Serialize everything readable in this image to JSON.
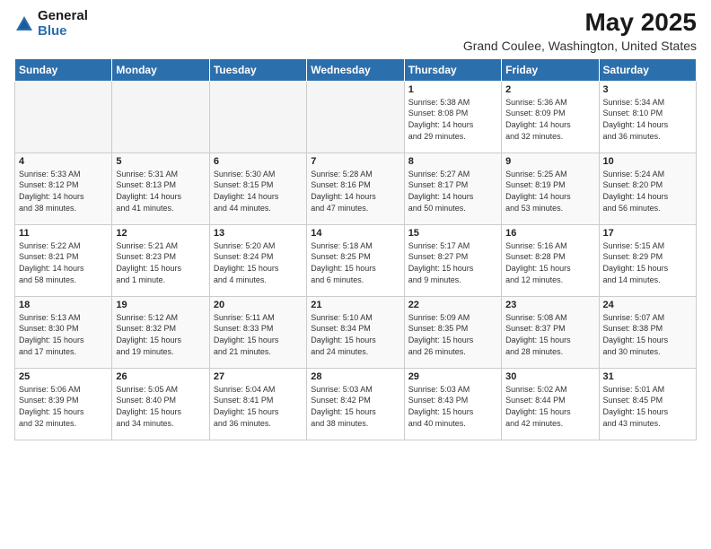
{
  "header": {
    "logo_general": "General",
    "logo_blue": "Blue",
    "main_title": "May 2025",
    "sub_title": "Grand Coulee, Washington, United States"
  },
  "weekdays": [
    "Sunday",
    "Monday",
    "Tuesday",
    "Wednesday",
    "Thursday",
    "Friday",
    "Saturday"
  ],
  "weeks": [
    [
      {
        "num": "",
        "info": ""
      },
      {
        "num": "",
        "info": ""
      },
      {
        "num": "",
        "info": ""
      },
      {
        "num": "",
        "info": ""
      },
      {
        "num": "1",
        "info": "Sunrise: 5:38 AM\nSunset: 8:08 PM\nDaylight: 14 hours\nand 29 minutes."
      },
      {
        "num": "2",
        "info": "Sunrise: 5:36 AM\nSunset: 8:09 PM\nDaylight: 14 hours\nand 32 minutes."
      },
      {
        "num": "3",
        "info": "Sunrise: 5:34 AM\nSunset: 8:10 PM\nDaylight: 14 hours\nand 36 minutes."
      }
    ],
    [
      {
        "num": "4",
        "info": "Sunrise: 5:33 AM\nSunset: 8:12 PM\nDaylight: 14 hours\nand 38 minutes."
      },
      {
        "num": "5",
        "info": "Sunrise: 5:31 AM\nSunset: 8:13 PM\nDaylight: 14 hours\nand 41 minutes."
      },
      {
        "num": "6",
        "info": "Sunrise: 5:30 AM\nSunset: 8:15 PM\nDaylight: 14 hours\nand 44 minutes."
      },
      {
        "num": "7",
        "info": "Sunrise: 5:28 AM\nSunset: 8:16 PM\nDaylight: 14 hours\nand 47 minutes."
      },
      {
        "num": "8",
        "info": "Sunrise: 5:27 AM\nSunset: 8:17 PM\nDaylight: 14 hours\nand 50 minutes."
      },
      {
        "num": "9",
        "info": "Sunrise: 5:25 AM\nSunset: 8:19 PM\nDaylight: 14 hours\nand 53 minutes."
      },
      {
        "num": "10",
        "info": "Sunrise: 5:24 AM\nSunset: 8:20 PM\nDaylight: 14 hours\nand 56 minutes."
      }
    ],
    [
      {
        "num": "11",
        "info": "Sunrise: 5:22 AM\nSunset: 8:21 PM\nDaylight: 14 hours\nand 58 minutes."
      },
      {
        "num": "12",
        "info": "Sunrise: 5:21 AM\nSunset: 8:23 PM\nDaylight: 15 hours\nand 1 minute."
      },
      {
        "num": "13",
        "info": "Sunrise: 5:20 AM\nSunset: 8:24 PM\nDaylight: 15 hours\nand 4 minutes."
      },
      {
        "num": "14",
        "info": "Sunrise: 5:18 AM\nSunset: 8:25 PM\nDaylight: 15 hours\nand 6 minutes."
      },
      {
        "num": "15",
        "info": "Sunrise: 5:17 AM\nSunset: 8:27 PM\nDaylight: 15 hours\nand 9 minutes."
      },
      {
        "num": "16",
        "info": "Sunrise: 5:16 AM\nSunset: 8:28 PM\nDaylight: 15 hours\nand 12 minutes."
      },
      {
        "num": "17",
        "info": "Sunrise: 5:15 AM\nSunset: 8:29 PM\nDaylight: 15 hours\nand 14 minutes."
      }
    ],
    [
      {
        "num": "18",
        "info": "Sunrise: 5:13 AM\nSunset: 8:30 PM\nDaylight: 15 hours\nand 17 minutes."
      },
      {
        "num": "19",
        "info": "Sunrise: 5:12 AM\nSunset: 8:32 PM\nDaylight: 15 hours\nand 19 minutes."
      },
      {
        "num": "20",
        "info": "Sunrise: 5:11 AM\nSunset: 8:33 PM\nDaylight: 15 hours\nand 21 minutes."
      },
      {
        "num": "21",
        "info": "Sunrise: 5:10 AM\nSunset: 8:34 PM\nDaylight: 15 hours\nand 24 minutes."
      },
      {
        "num": "22",
        "info": "Sunrise: 5:09 AM\nSunset: 8:35 PM\nDaylight: 15 hours\nand 26 minutes."
      },
      {
        "num": "23",
        "info": "Sunrise: 5:08 AM\nSunset: 8:37 PM\nDaylight: 15 hours\nand 28 minutes."
      },
      {
        "num": "24",
        "info": "Sunrise: 5:07 AM\nSunset: 8:38 PM\nDaylight: 15 hours\nand 30 minutes."
      }
    ],
    [
      {
        "num": "25",
        "info": "Sunrise: 5:06 AM\nSunset: 8:39 PM\nDaylight: 15 hours\nand 32 minutes."
      },
      {
        "num": "26",
        "info": "Sunrise: 5:05 AM\nSunset: 8:40 PM\nDaylight: 15 hours\nand 34 minutes."
      },
      {
        "num": "27",
        "info": "Sunrise: 5:04 AM\nSunset: 8:41 PM\nDaylight: 15 hours\nand 36 minutes."
      },
      {
        "num": "28",
        "info": "Sunrise: 5:03 AM\nSunset: 8:42 PM\nDaylight: 15 hours\nand 38 minutes."
      },
      {
        "num": "29",
        "info": "Sunrise: 5:03 AM\nSunset: 8:43 PM\nDaylight: 15 hours\nand 40 minutes."
      },
      {
        "num": "30",
        "info": "Sunrise: 5:02 AM\nSunset: 8:44 PM\nDaylight: 15 hours\nand 42 minutes."
      },
      {
        "num": "31",
        "info": "Sunrise: 5:01 AM\nSunset: 8:45 PM\nDaylight: 15 hours\nand 43 minutes."
      }
    ]
  ]
}
